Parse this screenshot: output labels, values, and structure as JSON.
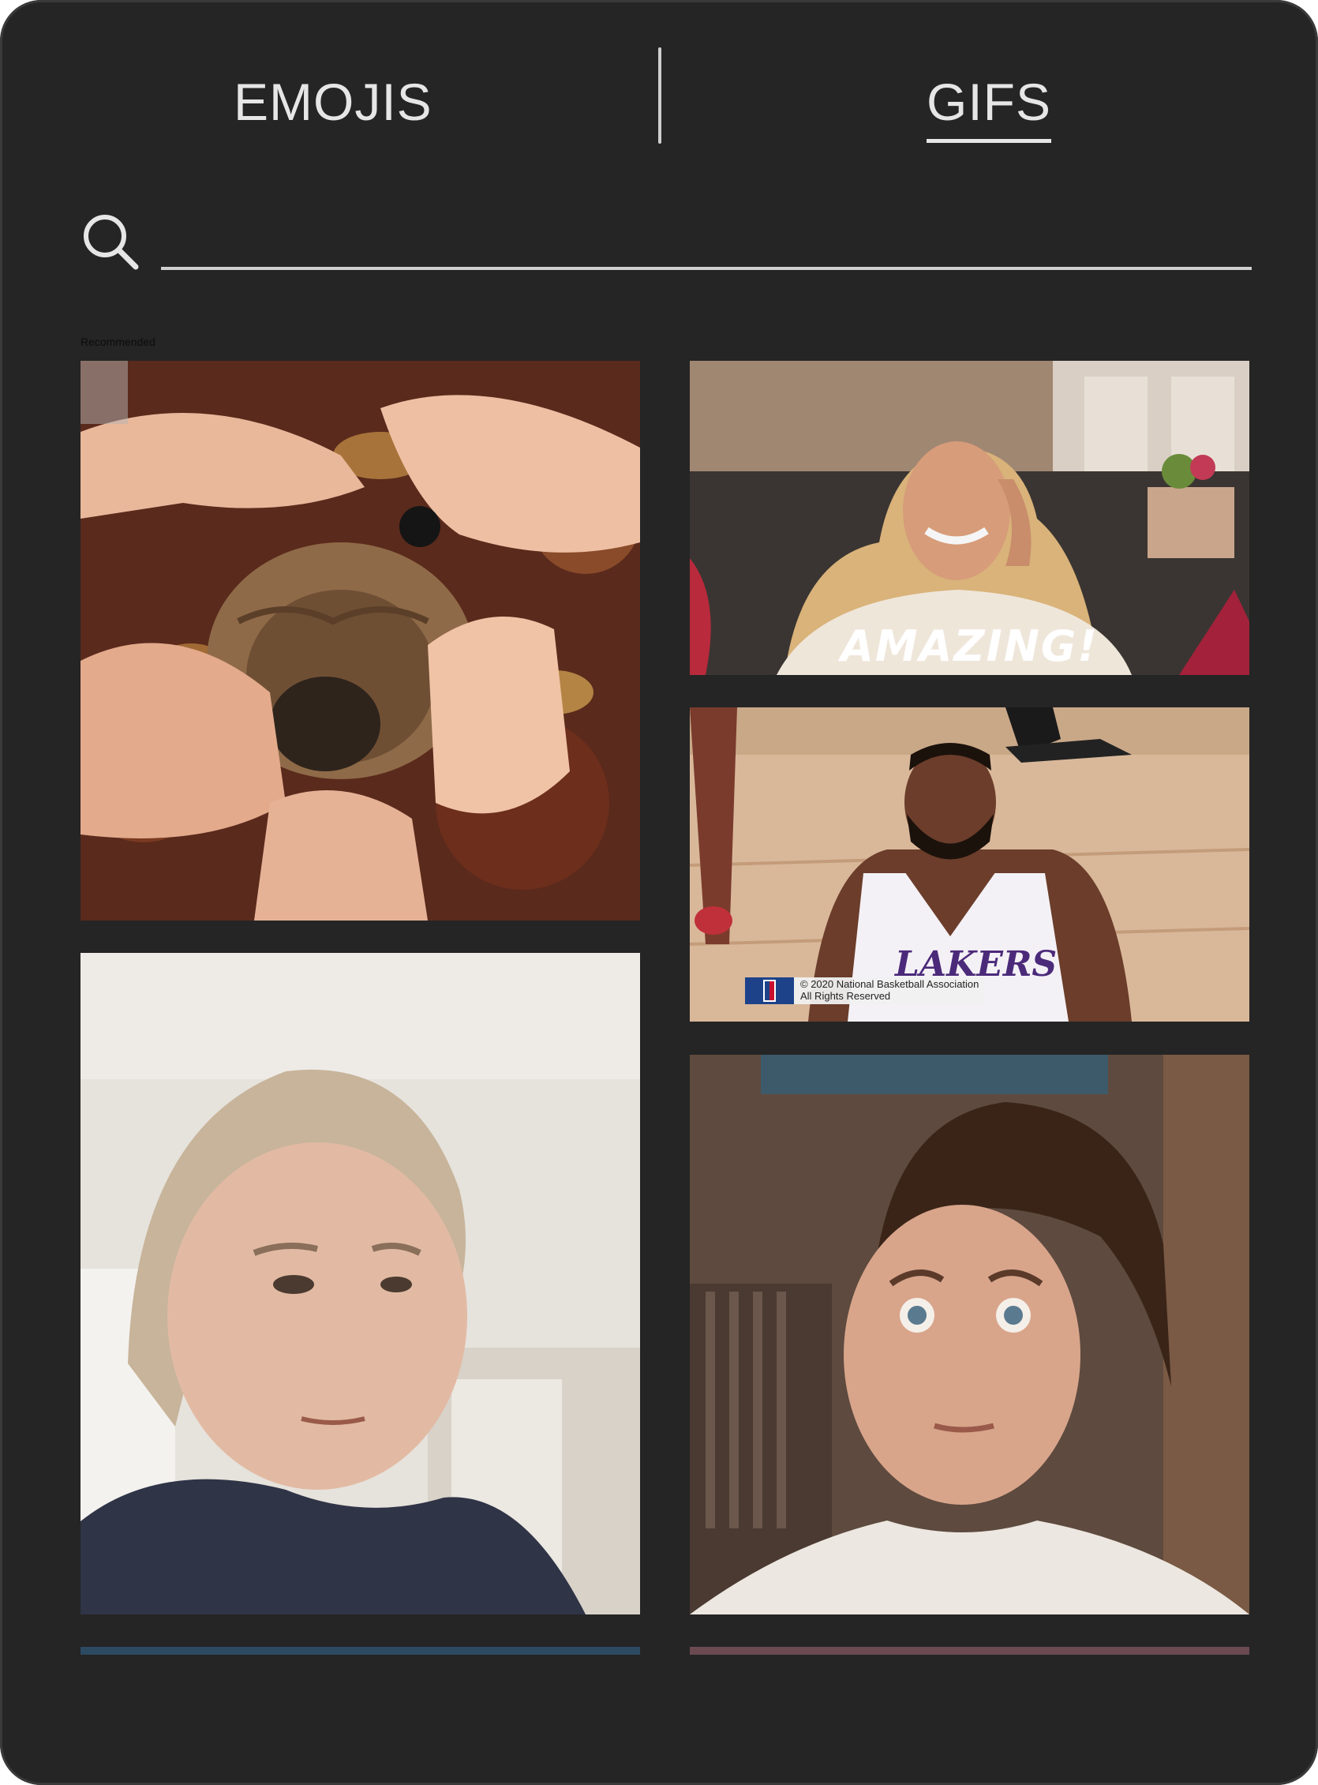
{
  "tabs": {
    "emojis_label": "EMOJIS",
    "gifs_label": "GIFS",
    "active": "GIFS"
  },
  "search": {
    "value": "",
    "placeholder": ""
  },
  "section": {
    "label": "Recommended"
  },
  "gifs": [
    {
      "subject": "pug-face-held-by-hands"
    },
    {
      "subject": "woman-smiling-amazing",
      "overlay_text": "AMAZING!"
    },
    {
      "subject": "basketball-player-lakers",
      "banner_line1": "© 2020 National Basketball Association",
      "banner_line2": "All Rights Reserved"
    },
    {
      "subject": "woman-side-glance"
    },
    {
      "subject": "woman-wide-eyed-stare"
    }
  ],
  "colors": {
    "panel_bg": "#252525",
    "text": "#e6e6e6",
    "divider": "#cfcfcf"
  },
  "icons": {
    "search": "search-icon"
  }
}
